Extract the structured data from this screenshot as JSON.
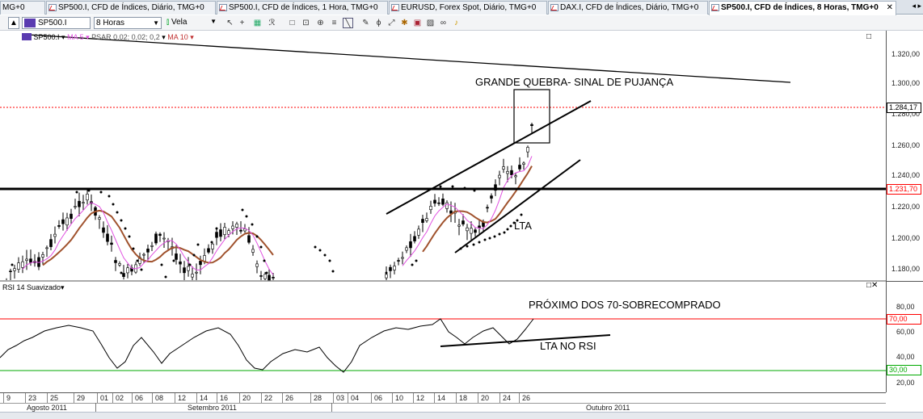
{
  "tabs": [
    {
      "label": "MG+0"
    },
    {
      "label": "SP500.I, CFD de Índices, Diário, TMG+0"
    },
    {
      "label": "SP500.I, CFD de Índices, 1 Hora, TMG+0"
    },
    {
      "label": "EURUSD, Forex Spot, Diário, TMG+0"
    },
    {
      "label": "DAX.I, CFD de Índices, Diário, TMG+0"
    },
    {
      "label": "SP500.I, CFD de Índices, 8 Horas, TMG+0"
    }
  ],
  "toolbar": {
    "symbol": "SP500.I",
    "timeframe": "8 Horas",
    "chart_type": "Vela"
  },
  "indicators": {
    "main_symbol": "SP500.I",
    "ma5": "MA 5",
    "psar": "PSAR 0,02; 0,02; 0,2",
    "ma10": "MA 10",
    "rsi": "RSI 14 Suavizado"
  },
  "annotations": {
    "breakout": "GRANDE QUEBRA- SINAL DE PUJANÇA",
    "lta": "LTA",
    "rsi_near70": "PRÓXIMO DOS 70-SOBRECOMPRADO",
    "lta_rsi": "LTA NO RSI"
  },
  "price_axis": [
    "1.320,00",
    "1.300,00",
    "1.280,00",
    "1.260,00",
    "1.240,00",
    "1.220,00",
    "1.200,00",
    "1.180,00"
  ],
  "price_tags": {
    "last": "1.284,17",
    "hline": "1.231,70"
  },
  "rsi_axis": [
    "80,00",
    "60,00",
    "40,00",
    "20,00"
  ],
  "rsi_tags": {
    "upper": "70,00",
    "lower": "30,00"
  },
  "date_ticks": [
    "9",
    "23",
    "25",
    "29",
    "01",
    "02",
    "06",
    "08",
    "12",
    "14",
    "16",
    "20",
    "22",
    "26",
    "28",
    "03",
    "04",
    "06",
    "10",
    "12",
    "14",
    "18",
    "20",
    "24",
    "26"
  ],
  "months": {
    "aug": "Agosto 2011",
    "sep": "Setembro 2011",
    "oct": "Outubro 2011"
  },
  "colors": {
    "rsi_upper": "#ff0000",
    "rsi_lower": "#009900",
    "ma5": "#e050e0",
    "ma10": "#a0522d",
    "last_price": "#ff0000"
  }
}
